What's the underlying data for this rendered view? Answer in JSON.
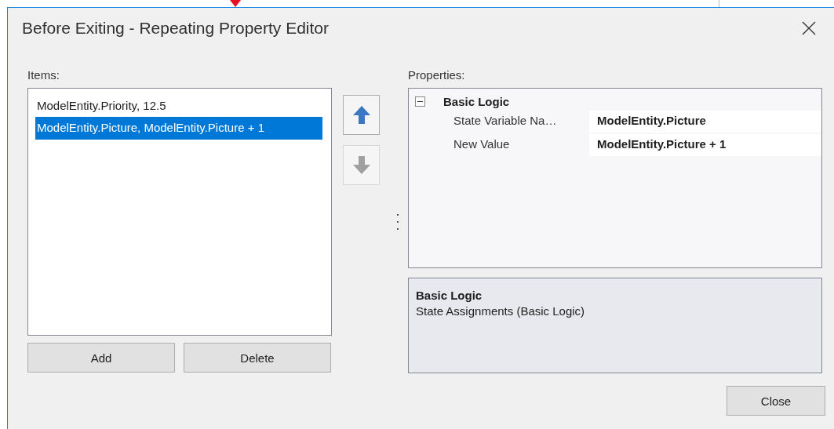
{
  "window": {
    "title": "Before Exiting - Repeating Property Editor"
  },
  "items": {
    "label": "Items:",
    "list": [
      {
        "text": "ModelEntity.Priority, 12.5",
        "selected": false
      },
      {
        "text": "ModelEntity.Picture, ModelEntity.Picture + 1",
        "selected": true
      }
    ]
  },
  "move_buttons": [
    {
      "kind": "up",
      "disabled": false
    },
    {
      "kind": "down",
      "disabled": true
    }
  ],
  "list_buttons": [
    "Add",
    "Delete"
  ],
  "properties": {
    "label": "Properties:",
    "category": {
      "name": "Basic Logic",
      "expanded": true
    },
    "rows": [
      {
        "name": "State Variable Na…",
        "value": "ModelEntity.Picture"
      },
      {
        "name": "New Value",
        "value": "ModelEntity.Picture + 1"
      }
    ]
  },
  "description": {
    "title": "Basic Logic",
    "text": "State Assignments (Basic Logic)"
  },
  "footer_button": "Close"
}
